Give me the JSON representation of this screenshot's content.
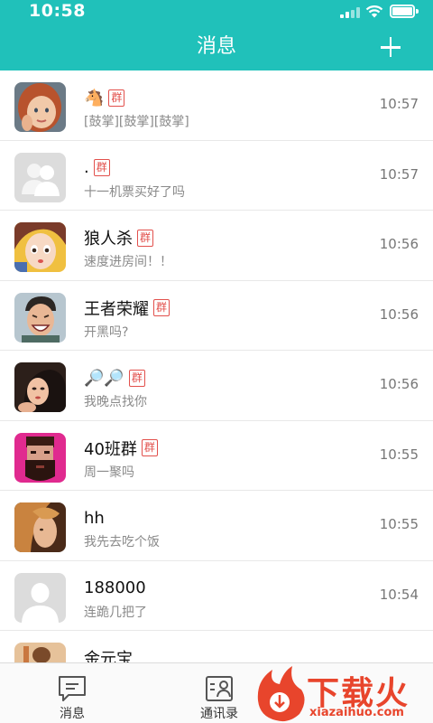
{
  "status_bar": {
    "time": "10:58"
  },
  "header": {
    "title": "消息",
    "add_icon": "plus-icon"
  },
  "group_tag": "群",
  "chats": [
    {
      "name": "🐴",
      "is_group": true,
      "preview": "[鼓掌][鼓掌][鼓掌]",
      "time": "10:57",
      "avatar": "avatar-girl-red-hair"
    },
    {
      "name": ".",
      "is_group": true,
      "preview": "十一机票买好了吗",
      "time": "10:57",
      "avatar": "avatar-default-group"
    },
    {
      "name": "狼人杀",
      "is_group": true,
      "preview": "速度进房间！！",
      "time": "10:56",
      "avatar": "avatar-cartoon-girl"
    },
    {
      "name": "王者荣耀",
      "is_group": true,
      "preview": "开黑吗?",
      "time": "10:56",
      "avatar": "avatar-laughing-man"
    },
    {
      "name": "🔎🔎",
      "is_group": true,
      "preview": "我晚点找你",
      "time": "10:56",
      "avatar": "avatar-illustrated-woman"
    },
    {
      "name": "40班群",
      "is_group": true,
      "preview": "周一聚吗",
      "time": "10:55",
      "avatar": "avatar-bearded-man-pink"
    },
    {
      "name": "hh",
      "is_group": false,
      "preview": "我先去吃个饭",
      "time": "10:55",
      "avatar": "avatar-blonde-side"
    },
    {
      "name": "188000",
      "is_group": false,
      "preview": "连跪几把了",
      "time": "10:54",
      "avatar": "avatar-default-person"
    },
    {
      "name": "金元宝",
      "is_group": false,
      "preview": "",
      "time": "",
      "avatar": "avatar-partial"
    }
  ],
  "tabs": [
    {
      "label": "消息",
      "icon": "message-icon"
    },
    {
      "label": "通讯录",
      "icon": "contacts-icon"
    }
  ],
  "watermark": {
    "brand": "下载火",
    "url": "xiazaihuo.com"
  },
  "colors": {
    "primary": "#20c1ba",
    "badge": "#e2504c",
    "watermark": "#e8452c"
  }
}
